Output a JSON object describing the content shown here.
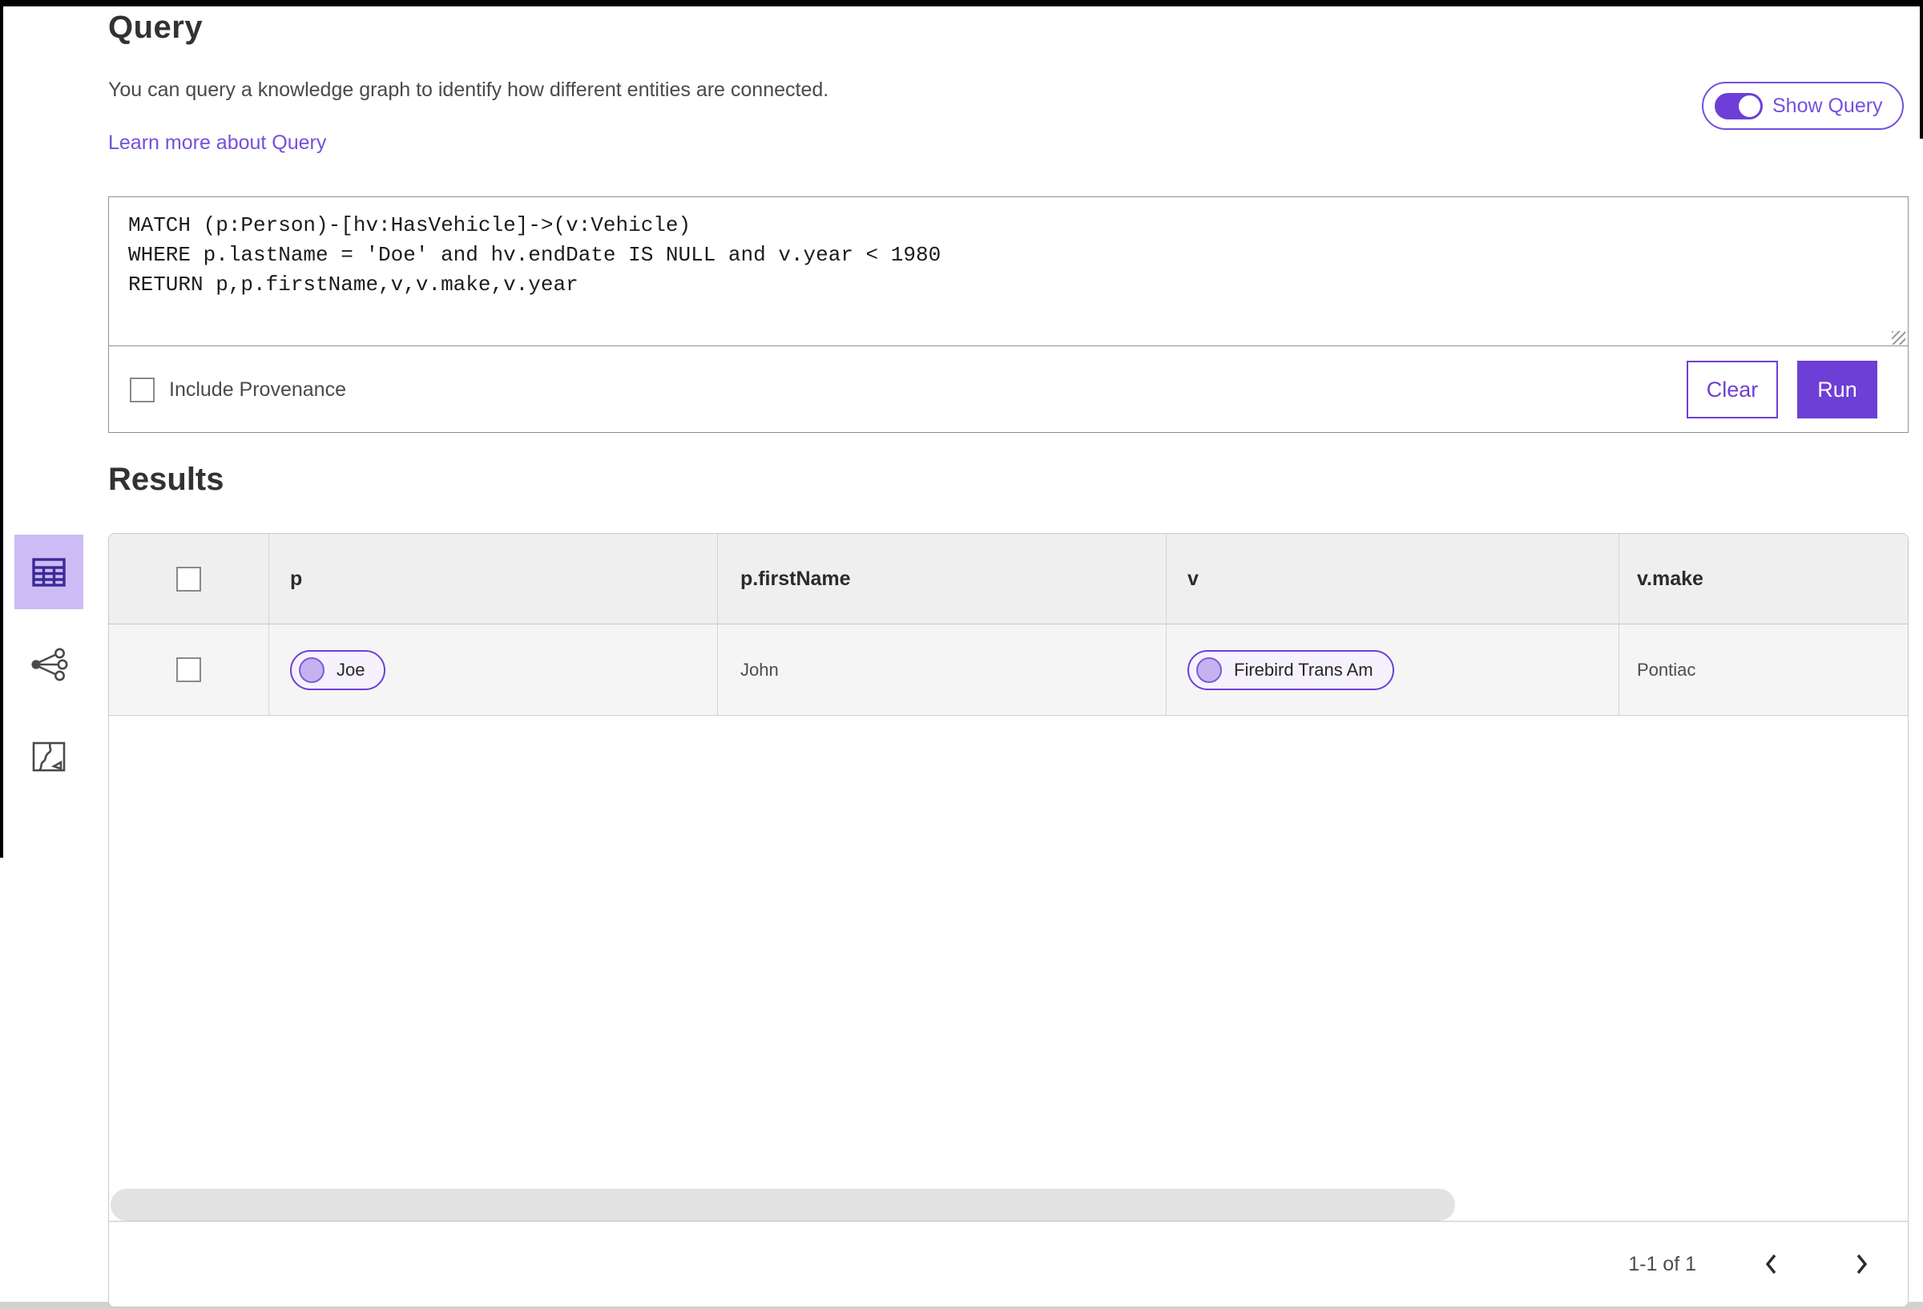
{
  "header": {
    "title": "Query",
    "description": "You can query a knowledge graph to identify how different entities are connected.",
    "learn_more_link": "Learn more about Query",
    "show_query_toggle": {
      "label": "Show Query",
      "state": "on"
    }
  },
  "query_editor": {
    "query_text": "MATCH (p:Person)-[hv:HasVehicle]->(v:Vehicle)\nWHERE p.lastName = 'Doe' and hv.endDate IS NULL and v.year < 1980\nRETURN p,p.firstName,v,v.make,v.year",
    "include_provenance": {
      "label": "Include Provenance",
      "checked": false
    },
    "buttons": {
      "clear": "Clear",
      "run": "Run"
    }
  },
  "results": {
    "title": "Results",
    "views": [
      {
        "name": "table-view",
        "icon": "table-icon",
        "active": true
      },
      {
        "name": "link-chart-view",
        "icon": "link-chart-icon",
        "active": false
      },
      {
        "name": "map-view",
        "icon": "map-icon",
        "active": false
      }
    ],
    "table": {
      "columns": [
        "p",
        "p.firstName",
        "v",
        "v.make"
      ],
      "rows": [
        {
          "p": {
            "kind": "entity-pill",
            "label": "Joe"
          },
          "p_firstName": "John",
          "v": {
            "kind": "entity-pill",
            "label": "Firebird Trans Am"
          },
          "v_make": "Pontiac"
        }
      ]
    },
    "pagination": {
      "range": "1-1 of 1"
    }
  },
  "colors": {
    "accent_purple": "#6d3fd6",
    "link_purple": "#7450dd",
    "active_tile_lavender": "#cdbbf5",
    "table_icon_indigo": "#3b2a96",
    "pill_background": "#f6f2fd",
    "pill_circle": "#c6b2ef",
    "header_row_gray": "#efefef",
    "data_row_gray": "#f5f5f5"
  }
}
